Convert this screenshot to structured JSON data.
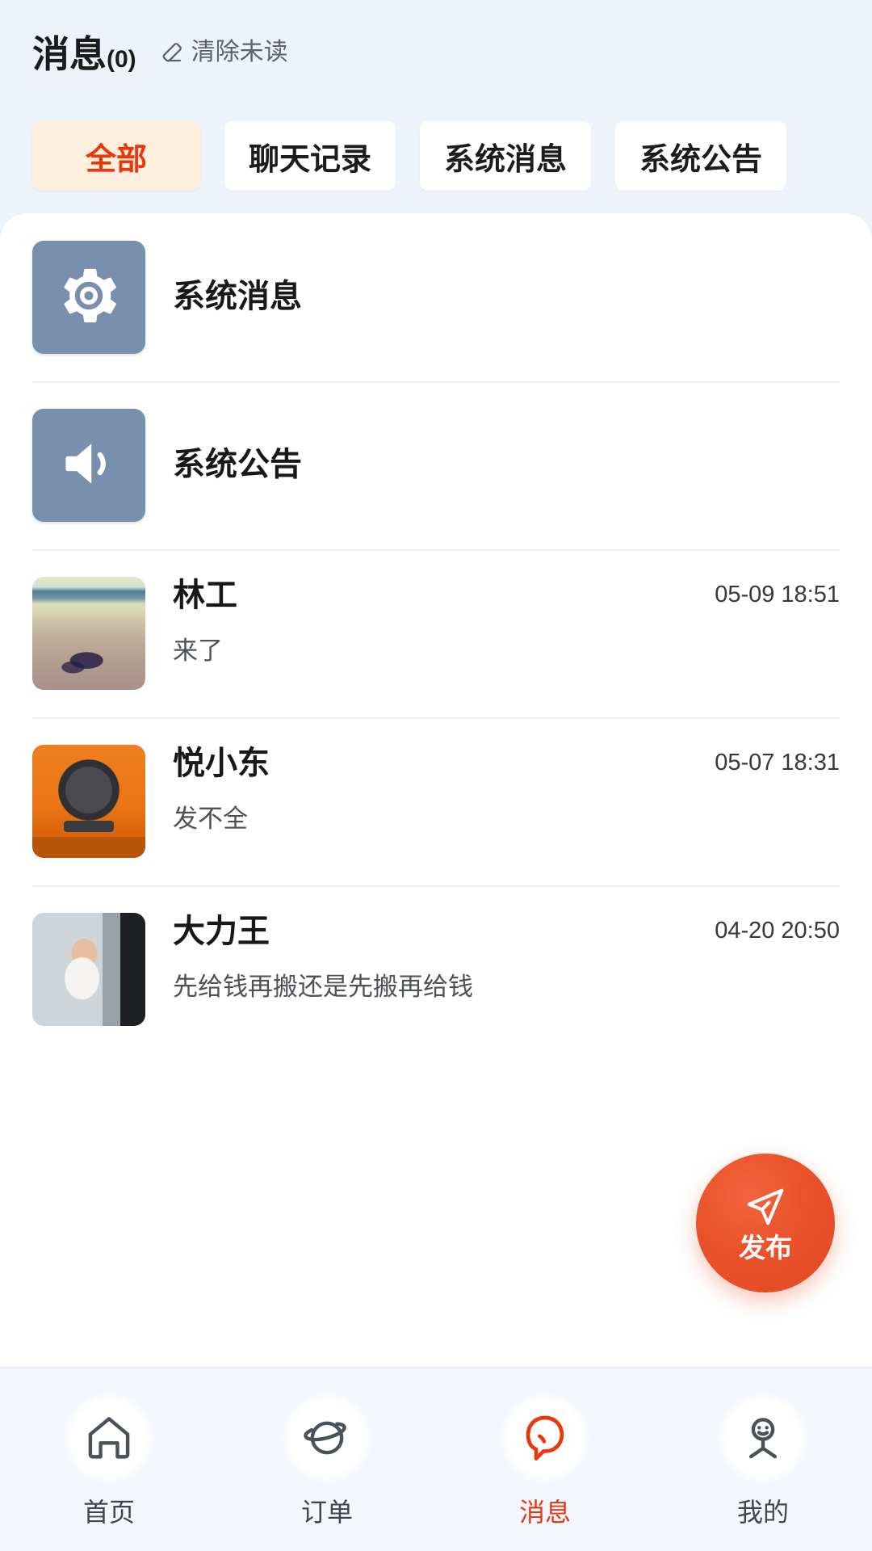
{
  "header": {
    "title": "消息",
    "count": "(0)",
    "clear_unread_label": "清除未读",
    "clear_unread_icon": "eraser-icon"
  },
  "tabs": [
    {
      "label": "全部",
      "active": true
    },
    {
      "label": "聊天记录",
      "active": false
    },
    {
      "label": "系统消息",
      "active": false
    },
    {
      "label": "系统公告",
      "active": false
    }
  ],
  "messages": [
    {
      "name": "系统消息",
      "preview": "",
      "time": "",
      "avatar_type": "system",
      "avatar_icon": "gear-icon"
    },
    {
      "name": "系统公告",
      "preview": "",
      "time": "",
      "avatar_type": "system",
      "avatar_icon": "speaker-icon"
    },
    {
      "name": "林工",
      "preview": "来了",
      "time": "05-09 18:51",
      "avatar_type": "photo-beach",
      "avatar_icon": "avatar-photo"
    },
    {
      "name": "悦小东",
      "preview": "发不全",
      "time": "05-07 18:31",
      "avatar_type": "photo-camera",
      "avatar_icon": "avatar-photo"
    },
    {
      "name": "大力王",
      "preview": "先给钱再搬还是先搬再给钱",
      "time": "04-20 20:50",
      "avatar_type": "photo-child",
      "avatar_icon": "avatar-photo"
    }
  ],
  "fab": {
    "label": "发布",
    "icon": "send-plane-icon"
  },
  "tabbar": [
    {
      "label": "首页",
      "icon": "home-icon",
      "active": false
    },
    {
      "label": "订单",
      "icon": "planet-icon",
      "active": false
    },
    {
      "label": "消息",
      "icon": "chat-bubble-icon",
      "active": true
    },
    {
      "label": "我的",
      "icon": "user-smile-icon",
      "active": false
    }
  ],
  "colors": {
    "accent": "#e8380d",
    "fab": "#e9512a",
    "tab_active_bg": "#fdeedd",
    "system_avatar": "#7890ad",
    "page_bg": "#eef2fa"
  }
}
